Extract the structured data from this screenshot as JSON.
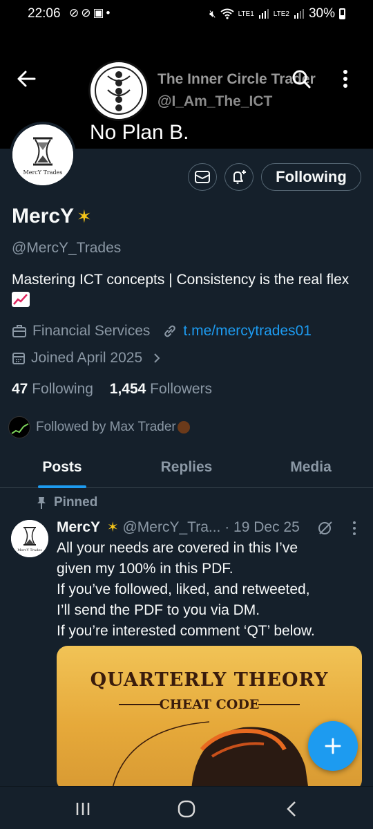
{
  "status_bar": {
    "time": "22:06",
    "battery": "30%",
    "sim1": "LTE1",
    "sim2": "LTE2"
  },
  "banner": {
    "account_name": "The Inner Circle Trader",
    "account_handle": "@I_Am_The_ICT",
    "tagline": "No Plan B."
  },
  "profile": {
    "name": "MercY",
    "handle": "@MercY_Trades",
    "bio": "Mastering ICT concepts | Consistency is the real flex",
    "category": "Financial Services",
    "link": "t.me/mercytrades01",
    "joined": "Joined April 2025",
    "following_count": "47",
    "following_label": "Following",
    "followers_count": "1,454",
    "followers_label": "Followers",
    "followed_by": "Followed by Max Trader",
    "follow_button": "Following",
    "avatar_text": "MercY Trades"
  },
  "tabs": [
    {
      "label": "Posts",
      "active": true
    },
    {
      "label": "Replies",
      "active": false
    },
    {
      "label": "Media",
      "active": false
    }
  ],
  "pinned_post": {
    "pinned_label": "Pinned",
    "author": "MercY",
    "handle": "@MercY_Tra...",
    "date": "· 19 Dec 25",
    "lines": [
      "All your needs are covered in this I’ve",
      "given my 100% in this PDF.",
      "If you’ve followed, liked, and retweeted,",
      "I’ll send the PDF to you via DM.",
      "If you’re interested comment ‘QT’ below."
    ],
    "media_title": "QUARTERLY THEORY",
    "media_subtitle": "CHEAT CODE"
  },
  "colors": {
    "background": "#15202b",
    "accent": "#1d9bf0",
    "secondary_text": "#8b98a5"
  }
}
